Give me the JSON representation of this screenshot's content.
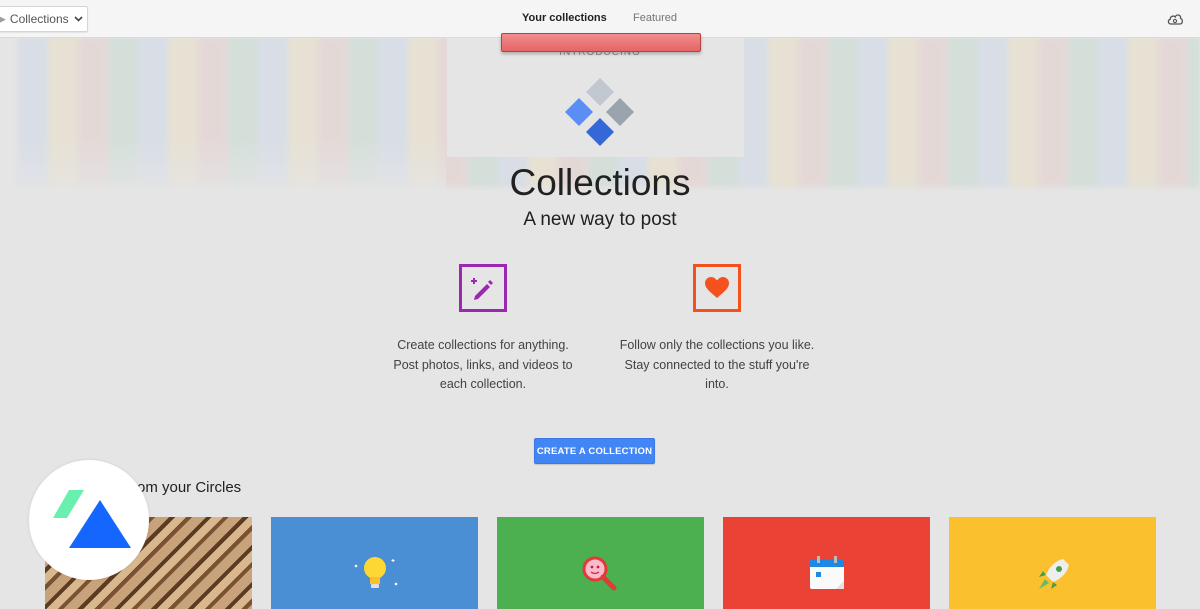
{
  "topbar": {
    "breadcrumb": "Collections",
    "tabs": [
      {
        "label": "Your collections",
        "active": true
      },
      {
        "label": "Featured",
        "active": false
      }
    ]
  },
  "hero": {
    "eyebrow": "INTRODUCING",
    "title": "Collections",
    "subtitle": "A new way to post"
  },
  "features": [
    {
      "icon": "edit-sparkle-icon",
      "color": "#9c27b0",
      "text": "Create collections for anything. Post photos, links, and videos to each collection."
    },
    {
      "icon": "heart-icon",
      "color": "#f4511e",
      "text": "Follow only the collections you like. Stay connected to the stuff you're into."
    }
  ],
  "cta": {
    "label": "CREATE A COLLECTION",
    "color": "#4285f4"
  },
  "circles": {
    "title": "rom your Circles",
    "cards": [
      {
        "icon": "wood-photo",
        "color": "#c8a27a"
      },
      {
        "icon": "lightbulb-icon",
        "color": "#4a8fd4"
      },
      {
        "icon": "magnifier-icon",
        "color": "#4caf50"
      },
      {
        "icon": "calendar-icon",
        "color": "#ea4335"
      },
      {
        "icon": "rocket-icon",
        "color": "#fbc02d"
      }
    ]
  }
}
